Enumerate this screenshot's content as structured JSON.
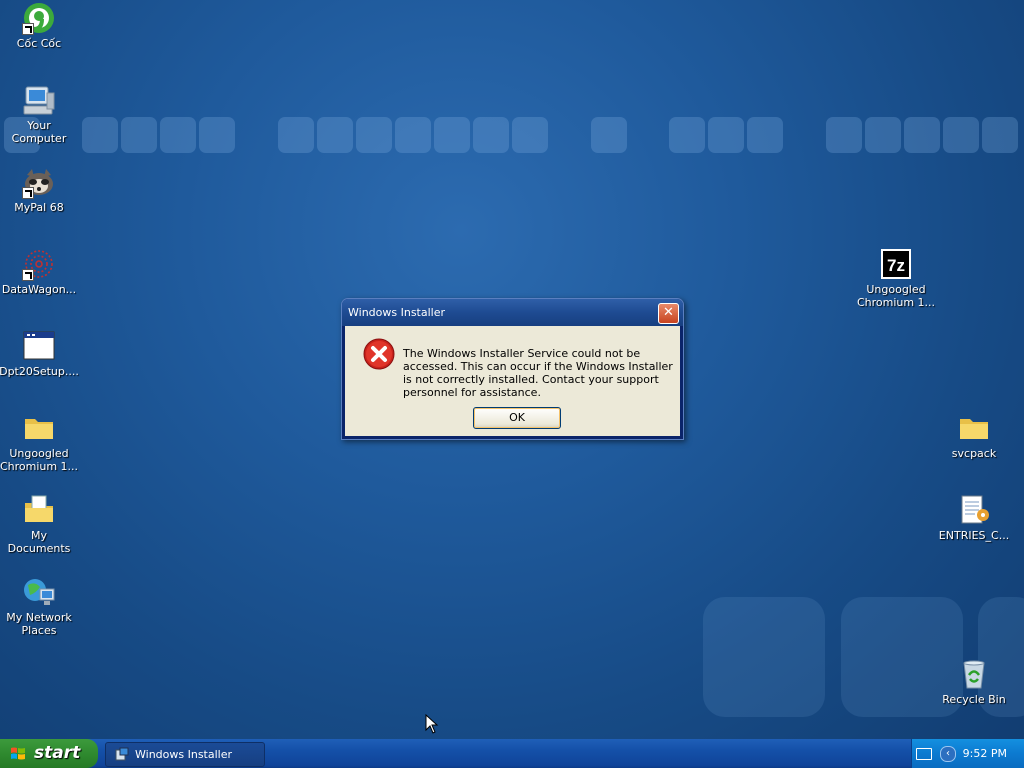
{
  "desktop": {
    "icons_left": [
      {
        "name": "coc-coc-icon",
        "label": "Cốc Cốc",
        "shortcut": true
      },
      {
        "name": "computer-icon",
        "label": "Your Computer",
        "shortcut": false
      },
      {
        "name": "mypal-icon",
        "label": "MyPal 68",
        "shortcut": true
      },
      {
        "name": "datawagon-icon",
        "label": "DataWagon...",
        "shortcut": true
      },
      {
        "name": "setup-window-icon",
        "label": "Dpt20Setup....",
        "shortcut": false
      },
      {
        "name": "folder-icon",
        "label": "Ungoogled Chromium 1...",
        "shortcut": false
      },
      {
        "name": "my-documents-icon",
        "label": "My Documents",
        "shortcut": false
      },
      {
        "name": "network-places-icon",
        "label": "My Network Places",
        "shortcut": false
      }
    ],
    "icons_right": [
      {
        "name": "7zip-archive-icon",
        "label": "Ungoogled Chromium 1..."
      },
      {
        "name": "folder-icon",
        "label": "svcpack"
      },
      {
        "name": "notepad-file-icon",
        "label": "ENTRIES_C..."
      },
      {
        "name": "recycle-bin-icon",
        "label": "Recycle Bin"
      }
    ]
  },
  "dialog": {
    "title": "Windows Installer",
    "close_glyph": "✕",
    "icon": "error-icon",
    "message": "The Windows Installer Service could not be accessed. This can occur if the Windows Installer is not correctly installed. Contact your support personnel for assistance.",
    "ok_label": "OK"
  },
  "taskbar": {
    "start_label": "start",
    "task_label": "Windows Installer",
    "clock": "9:52 PM"
  },
  "colors": {
    "desktop": "#1f5a9c",
    "taskbar": "#1450a8",
    "start": "#2f8a2f",
    "error_red": "#c8221b"
  }
}
